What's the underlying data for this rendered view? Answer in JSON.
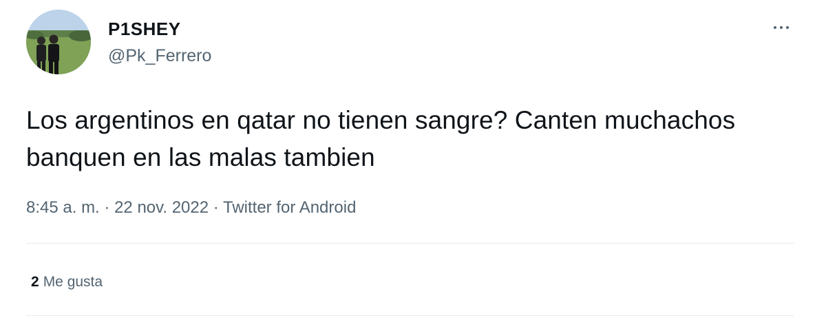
{
  "author": {
    "display_name": "P1SHEY",
    "handle": "@Pk_Ferrero",
    "avatar_icon": "profile-photo-two-people-on-field"
  },
  "tweet": {
    "text": "Los argentinos en qatar no tienen sangre? Canten muchachos banquen en las malas tambien"
  },
  "meta": {
    "time": "8:45 a. m.",
    "separator": "·",
    "date": "22 nov. 2022",
    "source": "Twitter for Android"
  },
  "stats": {
    "likes_count": "2",
    "likes_label": "Me gusta"
  },
  "icons": {
    "more": "more-horizontal-icon"
  },
  "colors": {
    "text_primary": "#0f1419",
    "text_secondary": "#536471",
    "divider": "#e6ecf0",
    "background": "#ffffff"
  }
}
